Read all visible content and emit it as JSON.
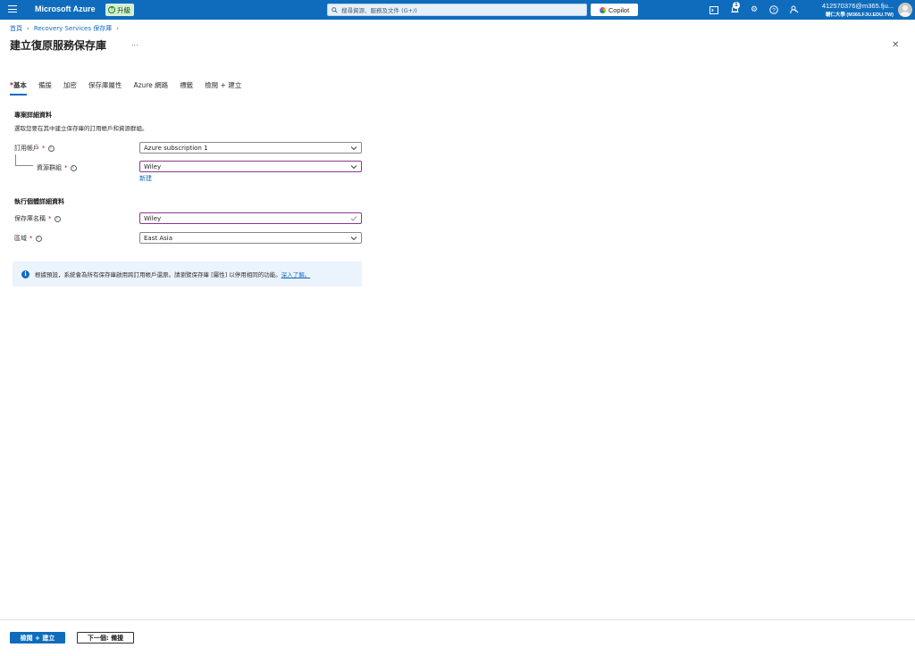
{
  "topbar": {
    "brand": "Microsoft Azure",
    "upgrade_label": "升級",
    "search_placeholder": "搜尋資源、服務及文件 (G+/)",
    "copilot_label": "Copilot",
    "notification_count": "1",
    "account_email": "412570376@m365.fju...",
    "account_org": "輔仁大學 (M365.FJU.EDU.TW)"
  },
  "breadcrumb": {
    "home": "首頁",
    "vaults": "Recovery Services 保存庫"
  },
  "page": {
    "title": "建立復原服務保存庫",
    "more": "...",
    "close": "✕"
  },
  "tabs": [
    {
      "label": "基本",
      "active": true,
      "required": true
    },
    {
      "label": "備援"
    },
    {
      "label": "加密"
    },
    {
      "label": "保存庫屬性"
    },
    {
      "label": "Azure 網路"
    },
    {
      "label": "標籤"
    },
    {
      "label": "檢閱 + 建立"
    }
  ],
  "project": {
    "title": "專案詳細資料",
    "desc": "選取您要在其中建立保存庫的訂用帳戶和資源群組。",
    "subscription_label": "訂用帳戶",
    "subscription_value": "Azure subscription 1",
    "resource_group_label": "資源群組",
    "resource_group_value": "Wiley",
    "new_link": "新建"
  },
  "instance": {
    "title": "執行個體詳細資料",
    "vault_name_label": "保存庫名稱",
    "vault_name_value": "Wiley",
    "region_label": "區域",
    "region_value": "East Asia"
  },
  "info": {
    "text": "根據預設，系統會為所有保存庫啟用跨訂用帳戶還原。請瀏覽保存庫 [屬性] 以停用相同的功能。",
    "link": "深入了解。"
  },
  "footer": {
    "primary": "檢閱 + 建立",
    "secondary": "下一個: 備援"
  },
  "colors": {
    "accent": "#0f6cbd",
    "focus_border": "#8a3a8a",
    "required": "#a4262c"
  }
}
